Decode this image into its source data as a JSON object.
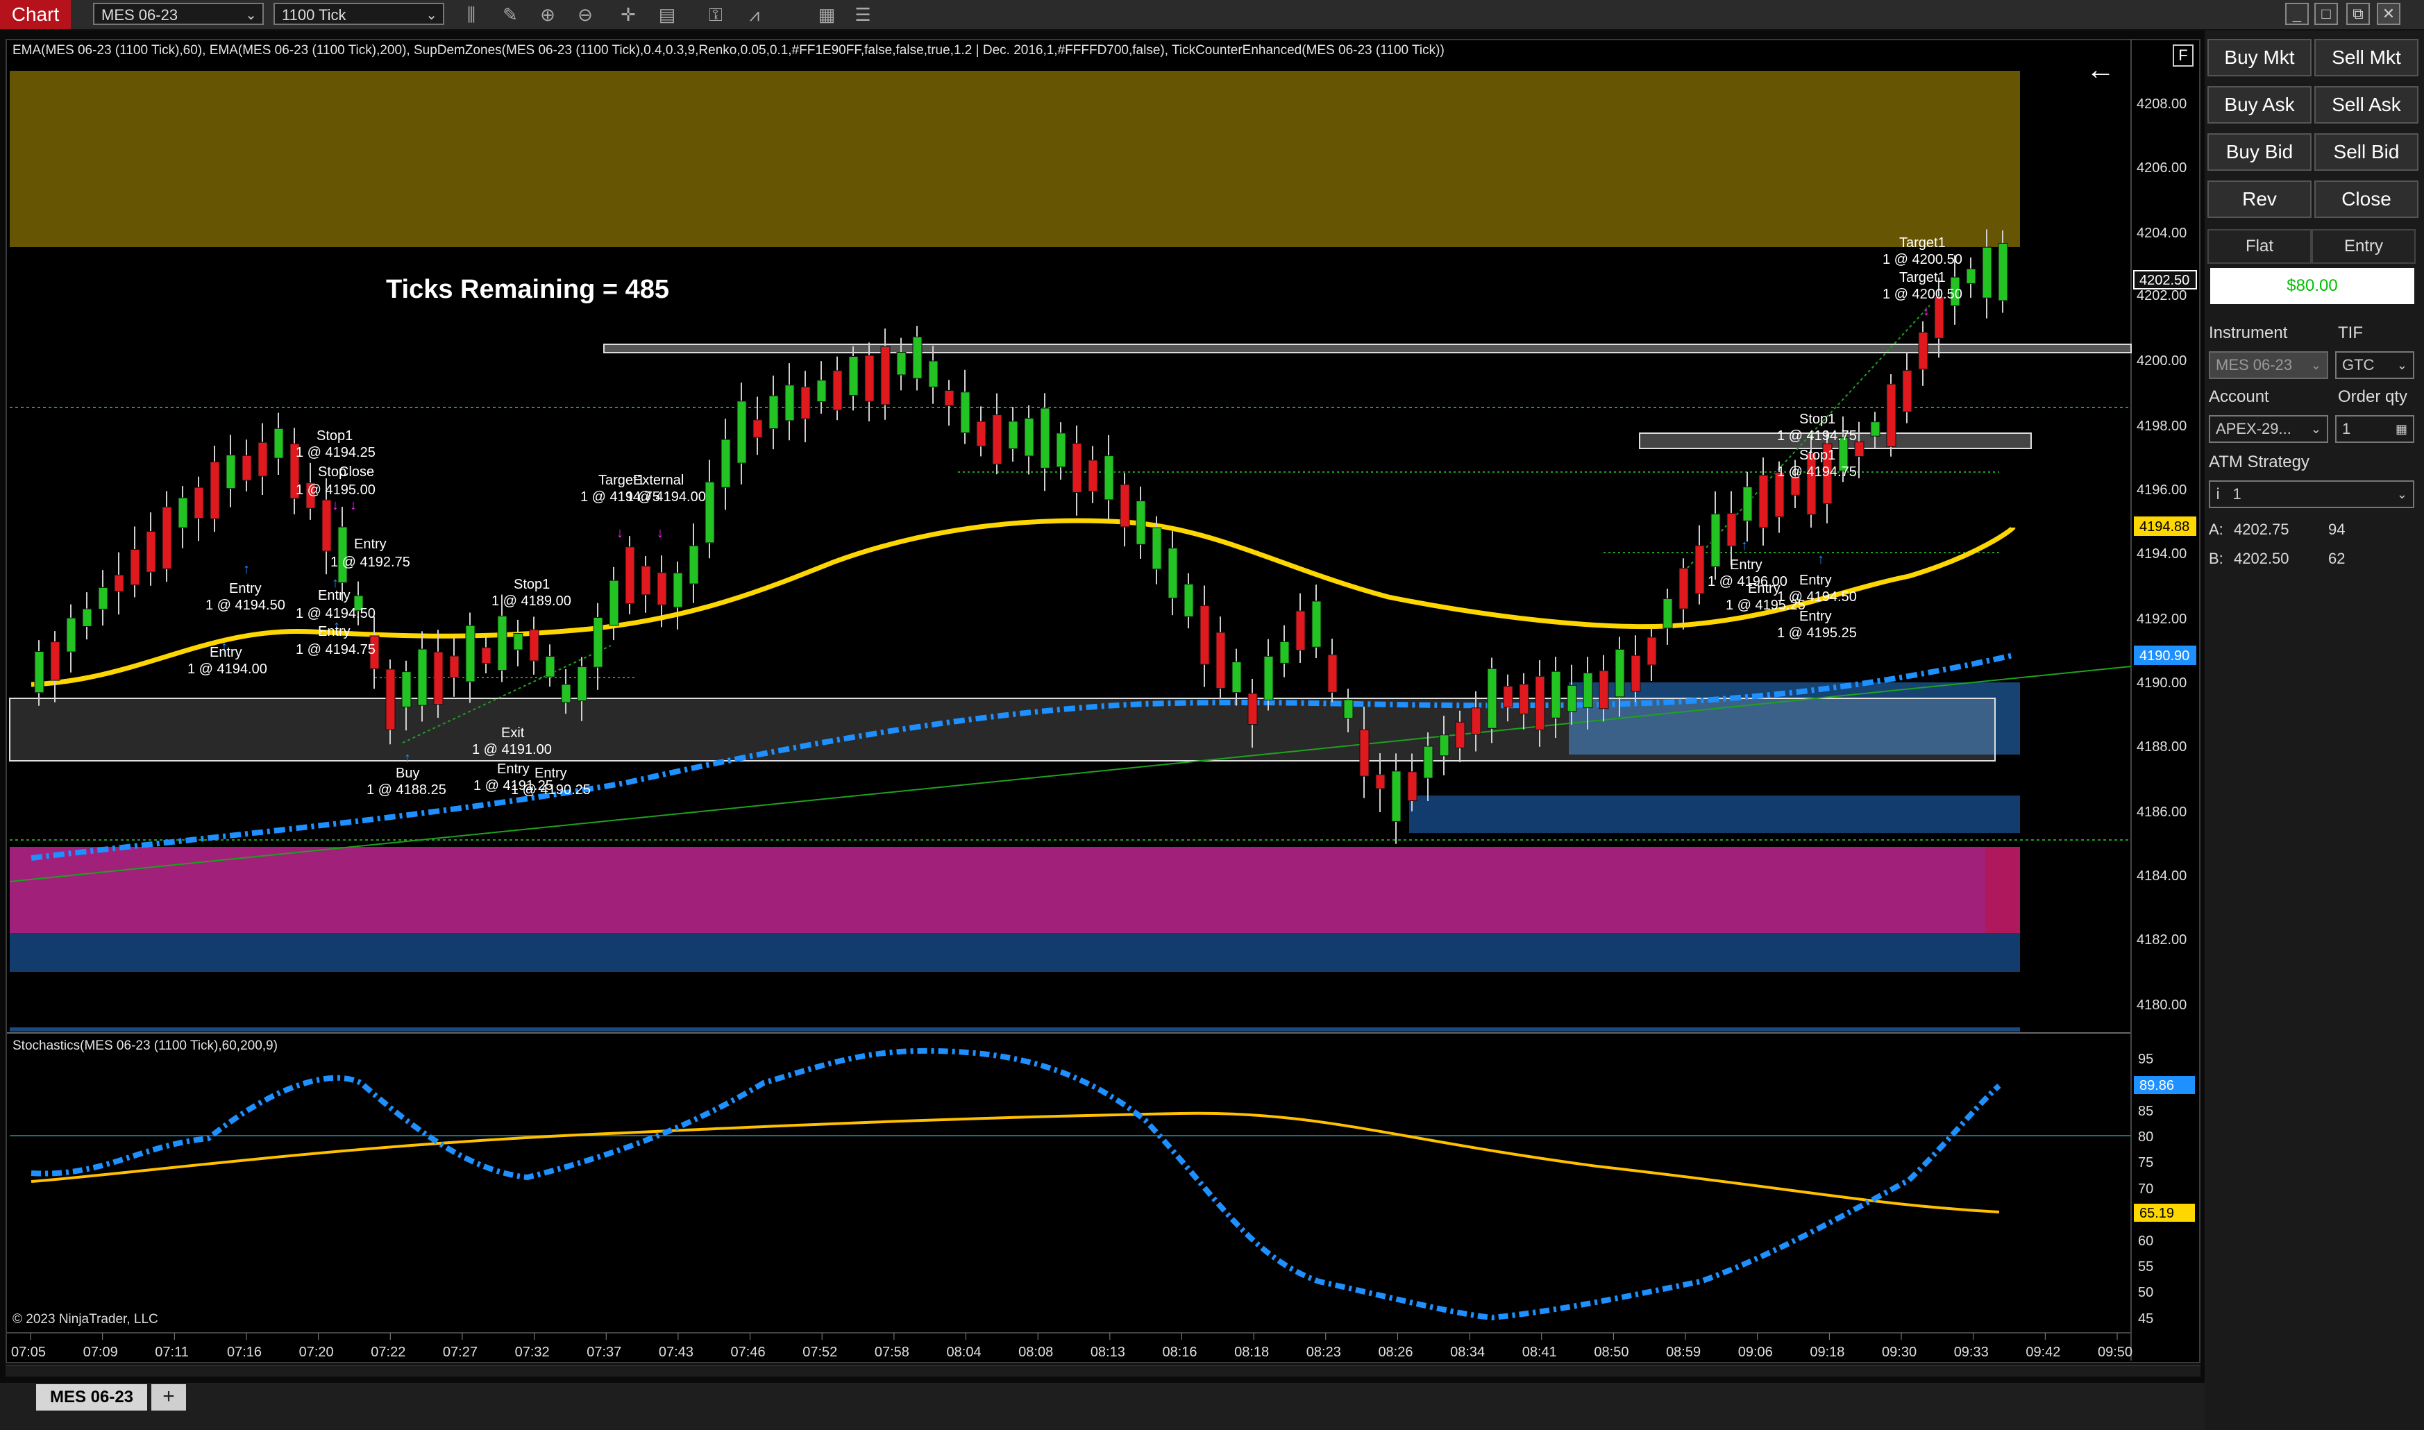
{
  "window": {
    "chart_tab": "Chart",
    "instrument": "MES 06-23",
    "interval": "1100 Tick",
    "controls": [
      "_",
      "□",
      "⧉",
      "✕"
    ]
  },
  "toolbar": {
    "icons": [
      "bar-type-icon",
      "draw-tool-icon",
      "zoom-in-icon",
      "zoom-out-icon",
      "crosshair-icon",
      "data-box-icon",
      "strategies-icon",
      "indicators-icon",
      "properties-icon",
      "chart-trader-icon"
    ]
  },
  "chart": {
    "indicator_label": "EMA(MES 06-23 (1100 Tick),60), EMA(MES 06-23 (1100 Tick),200), SupDemZones(MES 06-23 (1100 Tick),0.4,0.3,9,Renko,0.05,0.1,#FF1E90FF,false,false,true,1.2 | Dec. 2016,1,#FFFFD700,false), TickCounterEnhanced(MES 06-23 (1100 Tick))",
    "ticks_remaining": "Ticks Remaining = 485",
    "stochastics_label": "Stochastics(MES 06-23 (1100 Tick),60,200,9)",
    "copyright": "© 2023 NinjaTrader, LLC",
    "f_button": "F",
    "price_axis": [
      "4208.00",
      "4206.00",
      "4204.00",
      "4202.50",
      "4202.00",
      "4200.00",
      "4198.00",
      "4196.00",
      "4194.88",
      "4194.00",
      "4192.00",
      "4190.90",
      "4190.00",
      "4188.00",
      "4186.00",
      "4184.00",
      "4182.00",
      "4180.00"
    ],
    "price_tags": {
      "last": "4202.50",
      "ema60": "4194.88",
      "ema200": "4190.90"
    },
    "stoch_axis": [
      "95",
      "90",
      "85",
      "80",
      "75",
      "70",
      "65",
      "60",
      "55",
      "50",
      "45"
    ],
    "stoch_tags": {
      "d": "89.86",
      "k": "65.19"
    },
    "time_axis": [
      "07:05",
      "07:09",
      "07:11",
      "07:16",
      "07:20",
      "07:22",
      "07:27",
      "07:32",
      "07:37",
      "07:43",
      "07:46",
      "07:52",
      "07:58",
      "08:04",
      "08:08",
      "08:13",
      "08:16",
      "08:18",
      "08:23",
      "08:26",
      "08:34",
      "08:41",
      "08:50",
      "08:59",
      "09:06",
      "09:18",
      "09:30",
      "09:33",
      "09:42",
      "09:50"
    ],
    "trade_labels": [
      "Stop1",
      "1 @ 4194.25",
      "Stop",
      "Close",
      "1 @ 4195.00",
      "Entry",
      "1 @ 4192.75",
      "Entry",
      "1 @ 4194.50",
      "Entry",
      "1 @ 4194.50",
      "Entry",
      "1 @ 4194.75",
      "Entry",
      "1 @ 4194.00",
      "Buy",
      "1 @ 4188.25",
      "Exit",
      "1 @ 4191.00",
      "Entry",
      "1 @ 4191.25",
      "Entry",
      "1 @ 4190.25",
      "Stop1",
      "1 @ 4189.00",
      "Target1",
      "External",
      "1 @ 4194.75",
      "1 @ 4194.00",
      "Target1",
      "1 @ 4200.50",
      "Target1",
      "1 @ 4200.50",
      "Stop1",
      "1 @ 4194.75",
      "Stop1",
      "1 @ 4194.75",
      "Entry",
      "1 @ 4196.00",
      "Entry",
      "1 @ 4195.25",
      "Entry",
      "1 @ 4194.50",
      "Entry"
    ],
    "colors": {
      "ema60": "#FFD700",
      "ema200": "#1E90FF",
      "up": "#22c322",
      "down": "#e0191e",
      "supply": "#6b5a03",
      "demand_pink": "#a0207a",
      "demand_blue": "#123c6e"
    }
  },
  "bottom": {
    "instrument_tab": "MES 06-23",
    "add_tab": "+"
  },
  "trader": {
    "buttons": [
      "Buy Mkt",
      "Sell Mkt",
      "Buy Ask",
      "Sell Ask",
      "Buy Bid",
      "Sell Bid",
      "Rev",
      "Close"
    ],
    "position_header": "Flat",
    "entry_header": "Entry",
    "pnl": "$80.00",
    "instrument_label": "Instrument",
    "instrument_value": "MES 06-23",
    "tif_label": "TIF",
    "tif_value": "GTC",
    "account_label": "Account",
    "account_value": "APEX-29...",
    "order_qty_label": "Order qty",
    "order_qty_value": "1",
    "atm_label": "ATM Strategy",
    "atm_value": "1",
    "ask_label": "A:",
    "ask_price": "4202.75",
    "ask_size": "94",
    "bid_label": "B:",
    "bid_price": "4202.50",
    "bid_size": "62"
  }
}
